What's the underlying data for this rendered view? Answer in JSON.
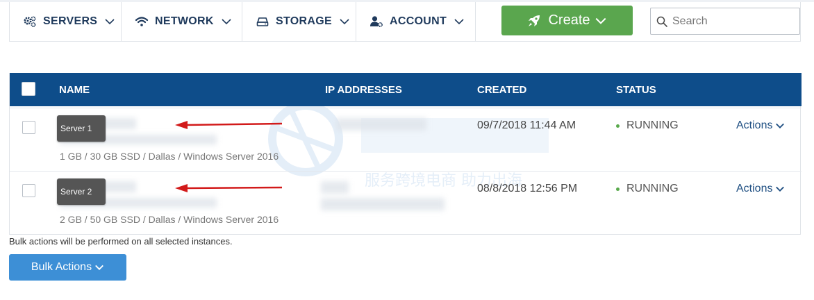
{
  "nav": {
    "servers": "SERVERS",
    "network": "NETWORK",
    "storage": "STORAGE",
    "account": "ACCOUNT",
    "create": "Create",
    "search_placeholder": "Search"
  },
  "table": {
    "headers": {
      "name": "NAME",
      "ip": "IP ADDRESSES",
      "created": "CREATED",
      "status": "STATUS"
    },
    "rows": [
      {
        "name": "Server 1",
        "specs": "1 GB / 30 GB SSD / Dallas / Windows Server 2016",
        "created": "09/7/2018 11:44 AM",
        "status": "RUNNING",
        "actions": "Actions"
      },
      {
        "name": "Server 2",
        "specs": "2 GB / 50 GB SSD / Dallas / Windows Server 2016",
        "created": "08/8/2018 12:56 PM",
        "status": "RUNNING",
        "actions": "Actions"
      }
    ]
  },
  "footer": {
    "hint": "Bulk actions will be performed on all selected instances.",
    "bulk_actions": "Bulk Actions"
  },
  "watermark": {
    "line2": "服务跨境电商 助力出海"
  },
  "colors": {
    "header_bg": "#0e4d8a",
    "create_bg": "#5aa64e",
    "bulk_bg": "#3d8fd6",
    "running_dot": "#58a94b",
    "annotation_arrow": "#d21a1a"
  }
}
